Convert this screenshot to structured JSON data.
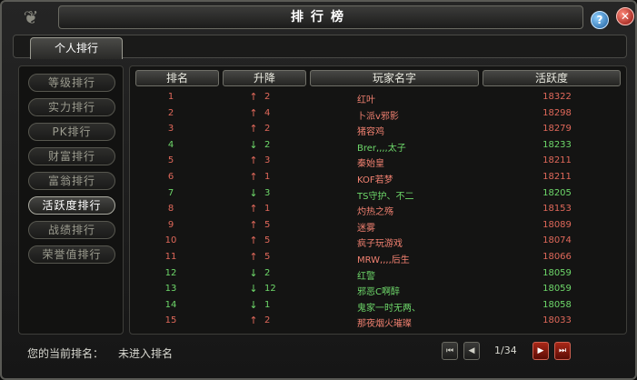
{
  "window": {
    "title": "排行榜"
  },
  "controls": {
    "help": "?",
    "close": "✕"
  },
  "tabs": [
    {
      "label": "个人排行"
    }
  ],
  "sidebar": {
    "items": [
      {
        "label": "等级排行",
        "active": false
      },
      {
        "label": "实力排行",
        "active": false
      },
      {
        "label": "PK排行",
        "active": false
      },
      {
        "label": "财富排行",
        "active": false
      },
      {
        "label": "富翁排行",
        "active": false
      },
      {
        "label": "活跃度排行",
        "active": true
      },
      {
        "label": "战绩排行",
        "active": false
      },
      {
        "label": "荣誉值排行",
        "active": false
      }
    ]
  },
  "table": {
    "headers": {
      "rank": "排名",
      "change": "升降",
      "name": "玩家名字",
      "activity": "活跃度"
    },
    "rows": [
      {
        "rank": "1",
        "dir": "up",
        "change": "2",
        "name": "红叶",
        "activity": "18322"
      },
      {
        "rank": "2",
        "dir": "up",
        "change": "4",
        "name": "卜派v邪影",
        "activity": "18298"
      },
      {
        "rank": "3",
        "dir": "up",
        "change": "2",
        "name": "猪容鸡",
        "activity": "18279"
      },
      {
        "rank": "4",
        "dir": "down",
        "change": "2",
        "name": "Brer,,,,太子",
        "activity": "18233"
      },
      {
        "rank": "5",
        "dir": "up",
        "change": "3",
        "name": "秦始皇",
        "activity": "18211"
      },
      {
        "rank": "6",
        "dir": "up",
        "change": "1",
        "name": "KOF若梦",
        "activity": "18211"
      },
      {
        "rank": "7",
        "dir": "down",
        "change": "3",
        "name": "TS守护、不二",
        "activity": "18205"
      },
      {
        "rank": "8",
        "dir": "up",
        "change": "1",
        "name": "灼热之殇",
        "activity": "18153"
      },
      {
        "rank": "9",
        "dir": "up",
        "change": "5",
        "name": "迷雾",
        "activity": "18089"
      },
      {
        "rank": "10",
        "dir": "up",
        "change": "5",
        "name": "疯子玩游戏",
        "activity": "18074"
      },
      {
        "rank": "11",
        "dir": "up",
        "change": "5",
        "name": "MRW,,,,后生",
        "activity": "18066"
      },
      {
        "rank": "12",
        "dir": "down",
        "change": "2",
        "name": "红警",
        "activity": "18059"
      },
      {
        "rank": "13",
        "dir": "down",
        "change": "12",
        "name": "邪恶C啊醉",
        "activity": "18059"
      },
      {
        "rank": "14",
        "dir": "down",
        "change": "1",
        "name": "鬼家一时无两、",
        "activity": "18058"
      },
      {
        "rank": "15",
        "dir": "up",
        "change": "2",
        "name": "那夜烟火璀璨",
        "activity": "18033"
      }
    ]
  },
  "footer": {
    "current_rank_label": "您的当前排名：",
    "current_rank_value": "未进入排名"
  },
  "pagination": {
    "page_text": "1/34",
    "first_icon": "first-page-icon",
    "prev_icon": "prev-page-icon",
    "next_icon": "next-page-icon",
    "last_icon": "last-page-icon"
  },
  "colors": {
    "up": "#e0685a",
    "down": "#6ed86a",
    "accent_red": "#a82818"
  }
}
